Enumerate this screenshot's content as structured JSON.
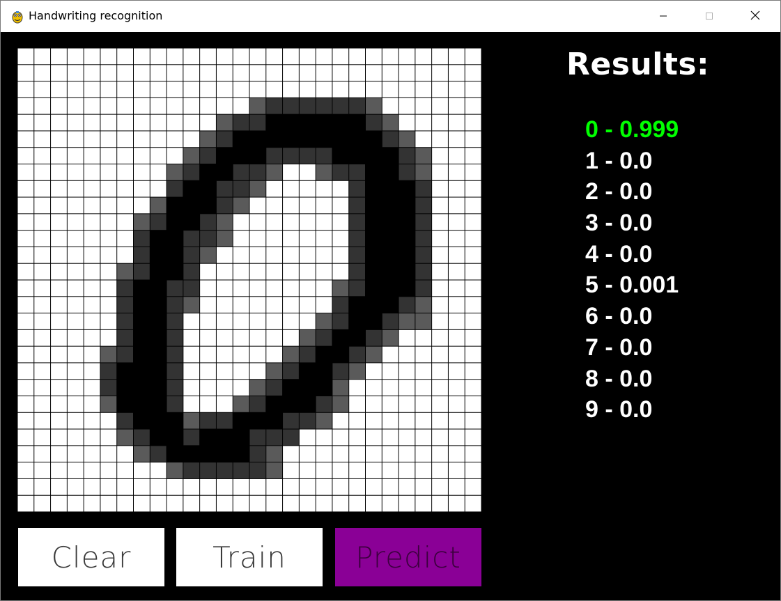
{
  "window": {
    "title": "Handwriting recognition",
    "icon": "pygame-snake-icon",
    "controls": [
      "minimize-icon",
      "maximize-icon",
      "close-icon"
    ]
  },
  "canvas": {
    "rows": 28,
    "cols": 28,
    "cell_colors": {
      "0": "#ffffff",
      "1": "#5a5a5a",
      "2": "#333333",
      "3": "#000000"
    },
    "pixels": [
      "0000000000000000000000000000",
      "0000000000000000000000000000",
      "0000000000000000000000000000",
      "0000000000000012222221000000",
      "0000000000001223333332100000",
      "0000000000012333333333210000",
      "0000000000123332222333321000",
      "0000000001233221001223321000",
      "0000000002332210000023332000",
      "0000000013332100000023332000",
      "0000000123321000000023332000",
      "0000000233221000000023332000",
      "0000000233210000000023332000",
      "0000001233200000000023332000",
      "0000002332200000000123332000",
      "0000002332100000000233321000",
      "0000002332000000001233211000",
      "0000002332000000012332100000",
      "0000012332000000123321000000",
      "0000023332000001233210000000",
      "0000023332000012333100000000",
      "0000013332000123332100000000",
      "0000002333122333221000000000",
      "0000001233233322200000000000",
      "0000000123333321000000000000",
      "0000000001222221000000000000",
      "0000000000000000000000000000",
      "0000000000000000000000000000"
    ]
  },
  "buttons": {
    "clear": "Clear",
    "train": "Train",
    "predict": "Predict"
  },
  "results": {
    "title": "Results:",
    "items": [
      {
        "label": "0 - 0.999",
        "color": "#00ff00"
      },
      {
        "label": "1 - 0.0",
        "color": "#ffffff"
      },
      {
        "label": "2 - 0.0",
        "color": "#ffffff"
      },
      {
        "label": "3 - 0.0",
        "color": "#ffffff"
      },
      {
        "label": "4 - 0.0",
        "color": "#ffffff"
      },
      {
        "label": "5 - 0.001",
        "color": "#ffffff"
      },
      {
        "label": "6 - 0.0",
        "color": "#ffffff"
      },
      {
        "label": "7 - 0.0",
        "color": "#ffffff"
      },
      {
        "label": "8 - 0.0",
        "color": "#ffffff"
      },
      {
        "label": "9 - 0.0",
        "color": "#ffffff"
      }
    ]
  },
  "colors": {
    "predict_button": "#8a0096",
    "highlight": "#00ff00"
  }
}
